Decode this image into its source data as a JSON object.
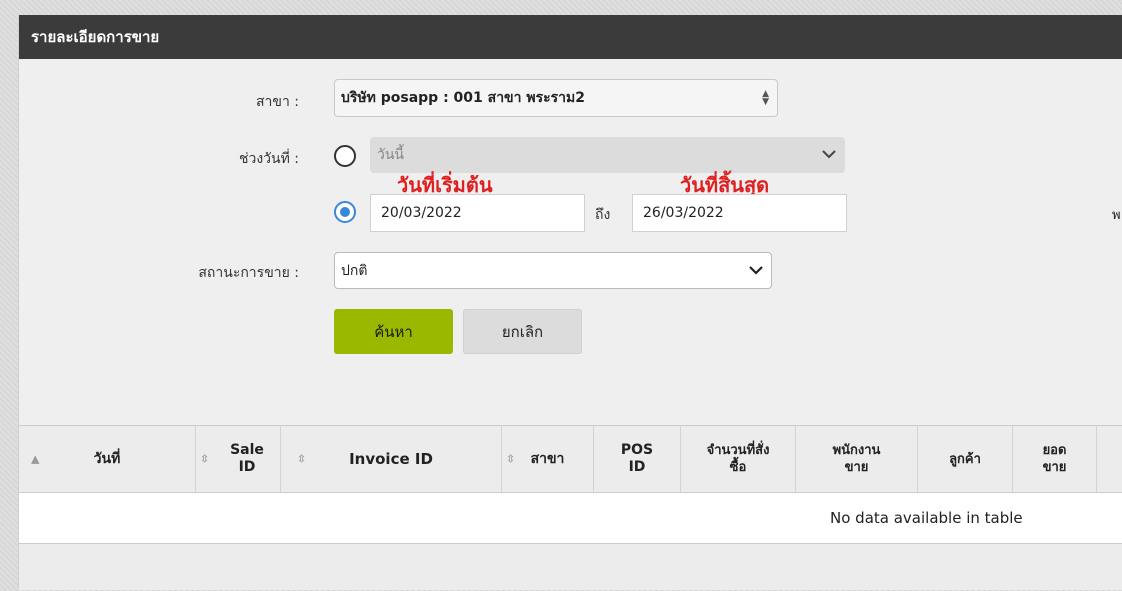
{
  "header": {
    "title": "รายละเอียดการขาย"
  },
  "form": {
    "branch_label": "สาขา :",
    "branch_value": "บริษัท posapp : 001 สาขา พระราม2",
    "date_range_label": "ช่วงวันที่ :",
    "preset_value": "วันนี้",
    "annot_start": "วันที่เริ่มต้น",
    "annot_end": "วันที่สิ้นสุด",
    "start_date": "20/03/2022",
    "to_label": "ถึง",
    "end_date": "26/03/2022",
    "status_label": "สถานะการขาย :",
    "status_value": "ปกติ",
    "search_label": "ค้นหา",
    "cancel_label": "ยกเลิก",
    "edge_char": "พ"
  },
  "table": {
    "columns": [
      {
        "label": "วันที่"
      },
      {
        "label": "Sale ID"
      },
      {
        "label": "Invoice ID"
      },
      {
        "label": "สาขา"
      },
      {
        "label": "POS ID"
      },
      {
        "label": "จำนวนที่สั่งซื้อ"
      },
      {
        "label": "พนักงานขาย"
      },
      {
        "label": "ลูกค้า"
      },
      {
        "label": "ยอดขาย"
      },
      {
        "label": ""
      }
    ],
    "empty_message": "No data available in table"
  },
  "icons": {
    "sort": "sort-icon",
    "sort_asc": "sort-asc-icon",
    "chevron": "chevron-down-icon"
  }
}
